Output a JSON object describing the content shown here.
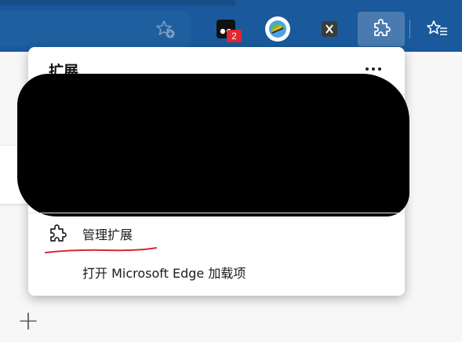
{
  "toolbar": {
    "buttons": [
      {
        "name": "favorite-add-icon",
        "icon": "star-plus"
      },
      {
        "name": "extension-1-icon",
        "icon": "black-square-ext",
        "badge": "2"
      },
      {
        "name": "idm-extension-icon",
        "icon": "globe-arrow"
      },
      {
        "name": "extension-x-icon",
        "icon": "x-box"
      },
      {
        "name": "extensions-puzzle-icon",
        "icon": "puzzle"
      },
      {
        "name": "favorites-icon",
        "icon": "star-list"
      }
    ],
    "badge": "2",
    "colors": {
      "bar": "#1a5a9c",
      "active": "#4a7bb0"
    }
  },
  "popup": {
    "title": "扩展",
    "more_label": "...",
    "manage_label": "管理扩展",
    "addons_label": "打开 Microsoft Edge 加载项"
  },
  "page": {
    "new_tab_plus": "+"
  }
}
